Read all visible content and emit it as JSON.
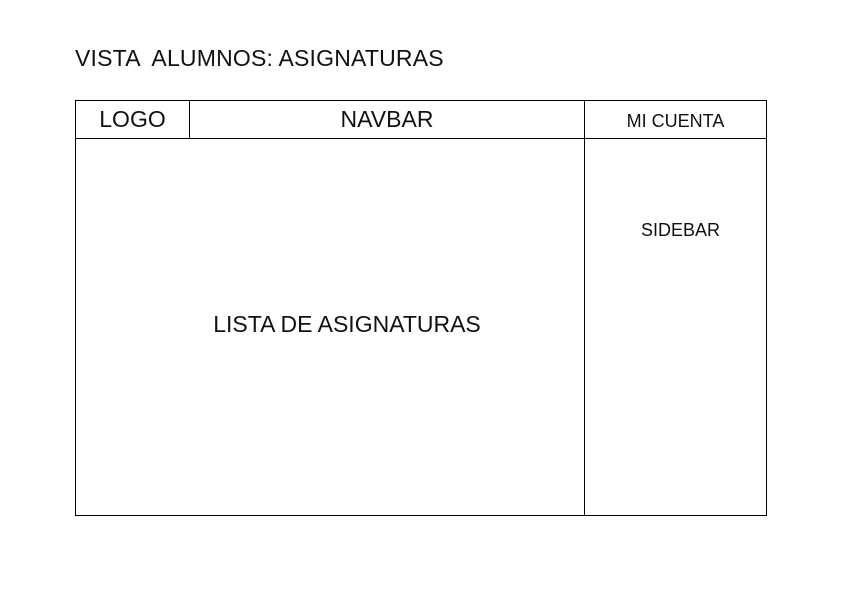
{
  "title": "VISTA  ALUMNOS: ASIGNATURAS",
  "header": {
    "logo": "LOGO",
    "navbar": "NAVBAR",
    "account": "MI CUENTA"
  },
  "main": {
    "label": "LISTA DE ASIGNATURAS"
  },
  "sidebar": {
    "label": "SIDEBAR"
  }
}
